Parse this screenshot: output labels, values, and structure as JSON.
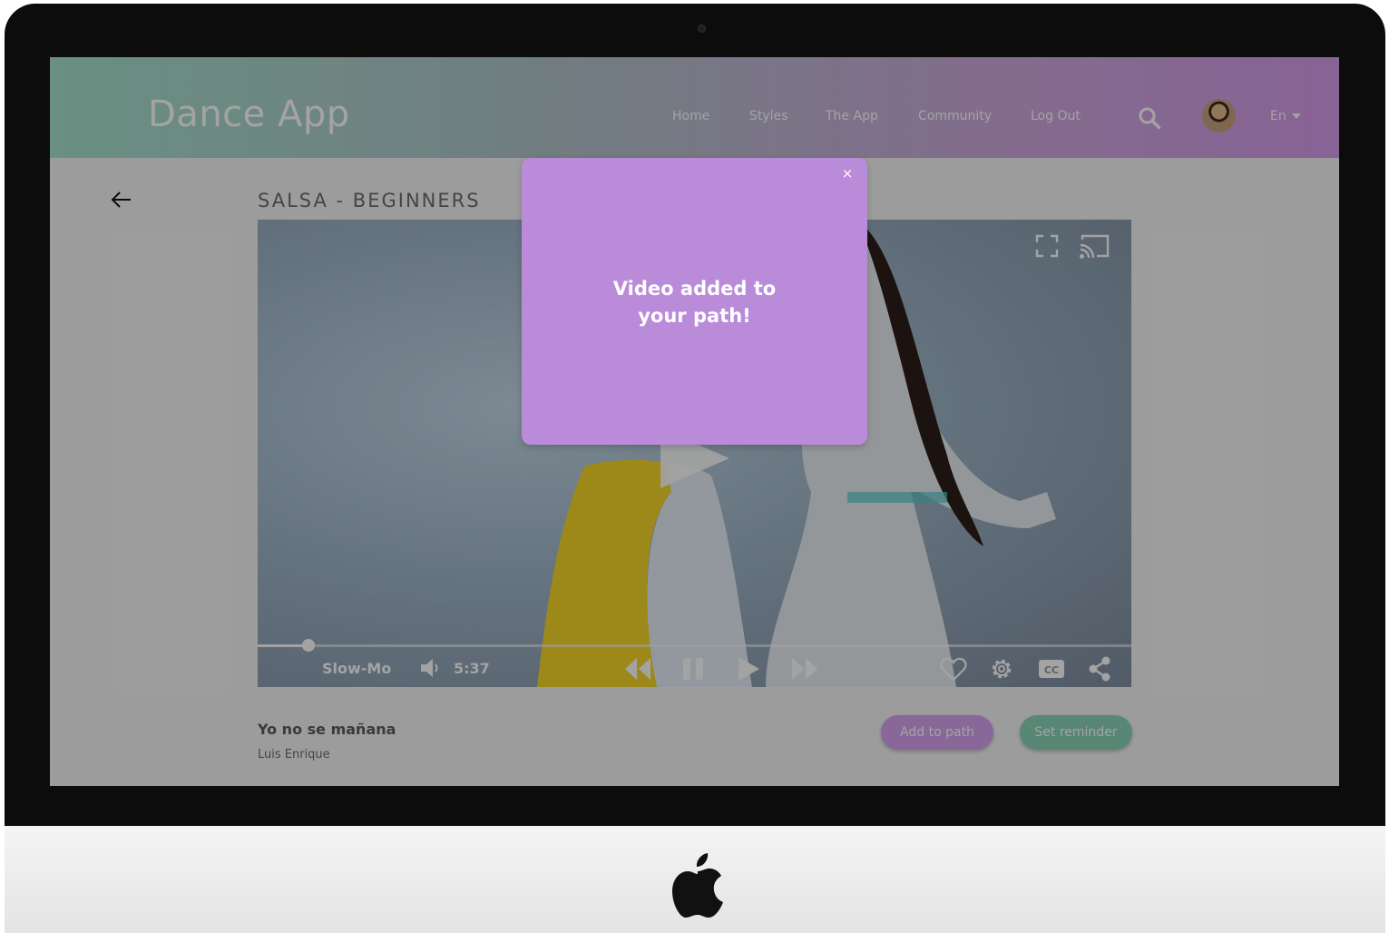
{
  "app": {
    "brand": "Dance App"
  },
  "nav": {
    "links": [
      "Home",
      "Styles",
      "The App",
      "Community",
      "Log Out"
    ],
    "language": "En"
  },
  "page": {
    "title": "SALSA - BEGINNERS"
  },
  "player": {
    "speed_label": "Slow-Mo",
    "time": "5:37",
    "progress": 0.058
  },
  "song": {
    "title": "Yo no se mañana",
    "artist": "Luis Enrique"
  },
  "actions": {
    "add_to_path": "Add to path",
    "set_reminder": "Set reminder"
  },
  "modal": {
    "close": "×",
    "message_line1": "Video added to",
    "message_line2": "your path!"
  },
  "icons": [
    "back-arrow-icon",
    "search-icon",
    "fullscreen-icon",
    "cast-icon",
    "play-icon",
    "volume-icon",
    "rewind-icon",
    "pause-icon",
    "play-icon",
    "fast-forward-icon",
    "heart-icon",
    "settings-icon",
    "closed-captions-icon",
    "share-icon",
    "apple-logo-icon"
  ],
  "colors": {
    "nav_gradient_start": "#a6e1cc",
    "nav_gradient_end": "#d59bea",
    "modal_bg": "#b98bd9",
    "add_button": "#d6a2ef",
    "reminder_button": "#8bd4b9"
  }
}
